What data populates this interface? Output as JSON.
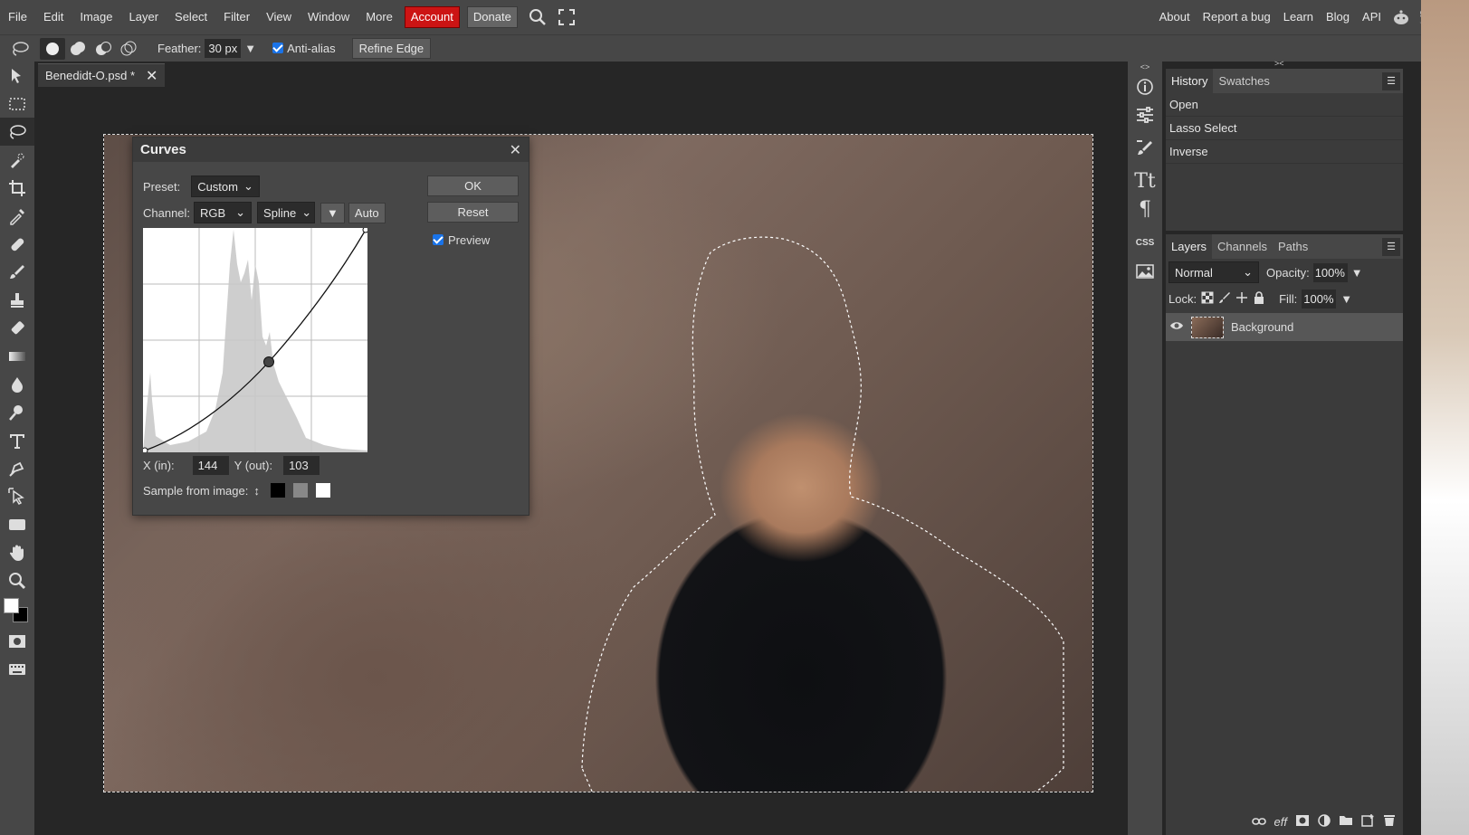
{
  "menubar": {
    "items": [
      "File",
      "Edit",
      "Image",
      "Layer",
      "Select",
      "Filter",
      "View",
      "Window",
      "More"
    ],
    "account": "Account",
    "donate": "Donate",
    "right_links": [
      "About",
      "Report a bug",
      "Learn",
      "Blog",
      "API"
    ]
  },
  "options": {
    "feather_label": "Feather:",
    "feather_value": "30 px",
    "antialias_label": "Anti-alias",
    "antialias_checked": true,
    "refine_edge": "Refine Edge"
  },
  "document": {
    "tab_title": "Benedidt-O.psd *"
  },
  "curves": {
    "title": "Curves",
    "preset_label": "Preset:",
    "preset_value": "Custom",
    "channel_label": "Channel:",
    "channel_value": "RGB",
    "interp_value": "Spline",
    "auto": "Auto",
    "ok": "OK",
    "reset": "Reset",
    "preview_label": "Preview",
    "preview_checked": true,
    "x_label": "X (in):",
    "x_value": "144",
    "y_label": "Y (out):",
    "y_value": "103",
    "sample_label": "Sample from image:",
    "control_point": {
      "in": 144,
      "out": 103
    }
  },
  "history": {
    "tabs": [
      "History",
      "Swatches"
    ],
    "items": [
      "Open",
      "Lasso Select",
      "Inverse"
    ]
  },
  "layers": {
    "tabs": [
      "Layers",
      "Channels",
      "Paths"
    ],
    "blend_mode": "Normal",
    "opacity_label": "Opacity:",
    "opacity_value": "100%",
    "lock_label": "Lock:",
    "fill_label": "Fill:",
    "fill_value": "100%",
    "items": [
      {
        "name": "Background"
      }
    ],
    "footer_eff": "eff"
  },
  "colors": {
    "accent_account": "#cc1414",
    "panel_bg": "#474747"
  }
}
